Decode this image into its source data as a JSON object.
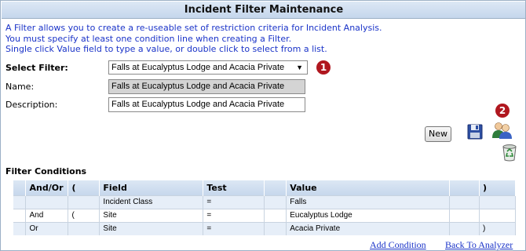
{
  "header": {
    "title": "Incident Filter Maintenance"
  },
  "intro": [
    "A Filter allows you to create a re-useable set of restriction criteria for Incident Analysis.",
    "You must specify at least one condition line when creating a Filter.",
    "Single click Value field to type a value, or double click to select from a list."
  ],
  "form": {
    "select_filter_label": "Select Filter:",
    "select_filter_value": "Falls at Eucalyptus Lodge and Acacia Private",
    "name_label": "Name:",
    "name_value": "Falls at Eucalyptus Lodge and Acacia Private",
    "description_label": "Description:",
    "description_value": "Falls at Eucalyptus Lodge and Acacia Private"
  },
  "markers": {
    "one": "1",
    "two": "2"
  },
  "toolbar": {
    "new_label": "New",
    "save_icon": "floppy-disk-icon",
    "users_icon": "users-icon",
    "recycle_icon": "recycle-bin-icon"
  },
  "conditions": {
    "title": "Filter Conditions",
    "headers": [
      "",
      "And/Or",
      "(",
      "Field",
      "Test",
      "",
      "Value",
      "",
      ")"
    ],
    "rows": [
      [
        "",
        "",
        "",
        "Incident Class",
        "=",
        "",
        "Falls",
        "",
        ""
      ],
      [
        "",
        "And",
        "(",
        "Site",
        "=",
        "",
        "Eucalyptus Lodge",
        "",
        ""
      ],
      [
        "",
        "Or",
        "",
        "Site",
        "=",
        "",
        "Acacia Private",
        "",
        ")"
      ]
    ]
  },
  "links": {
    "add_condition": "Add Condition",
    "back_to_analyzer": "Back To Analyzer"
  },
  "colors": {
    "marker": "#b0171f",
    "intro_text": "#1a33c8",
    "link": "#1a33c8",
    "header_bg": "#c4d6ec"
  }
}
